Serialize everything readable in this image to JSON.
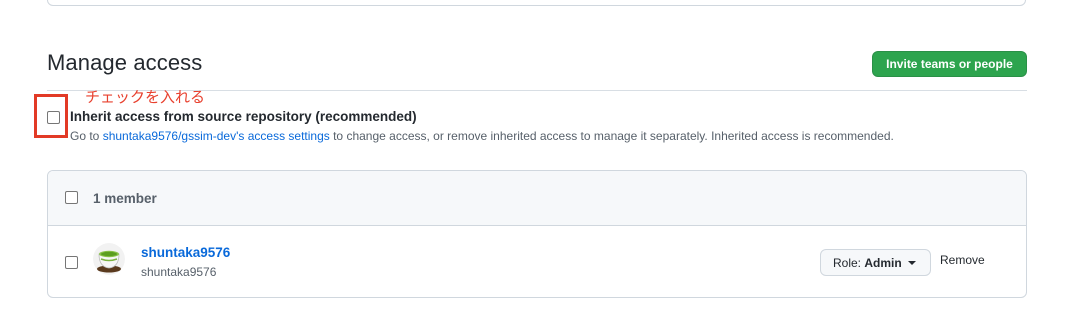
{
  "section": {
    "title": "Manage access",
    "invite_button": "Invite teams or people"
  },
  "annotation": {
    "text": "チェックを入れる",
    "color": "#e23a26"
  },
  "inherit": {
    "label": "Inherit access from source repository (recommended)",
    "desc_prefix": "Go to ",
    "desc_link": "shuntaka9576/gssim-dev's access settings",
    "desc_suffix": " to change access, or remove inherited access to manage it separately. Inherited access is recommended.",
    "checked": false
  },
  "members": {
    "count_label": "1 member",
    "rows": [
      {
        "name": "shuntaka9576",
        "subname": "shuntaka9576",
        "role_prefix": "Role: ",
        "role": "Admin",
        "remove_label": "Remove",
        "avatar_icon": "green-tea-cup-icon"
      }
    ]
  },
  "colors": {
    "primary_button": "#2da44e",
    "link": "#0969da"
  }
}
